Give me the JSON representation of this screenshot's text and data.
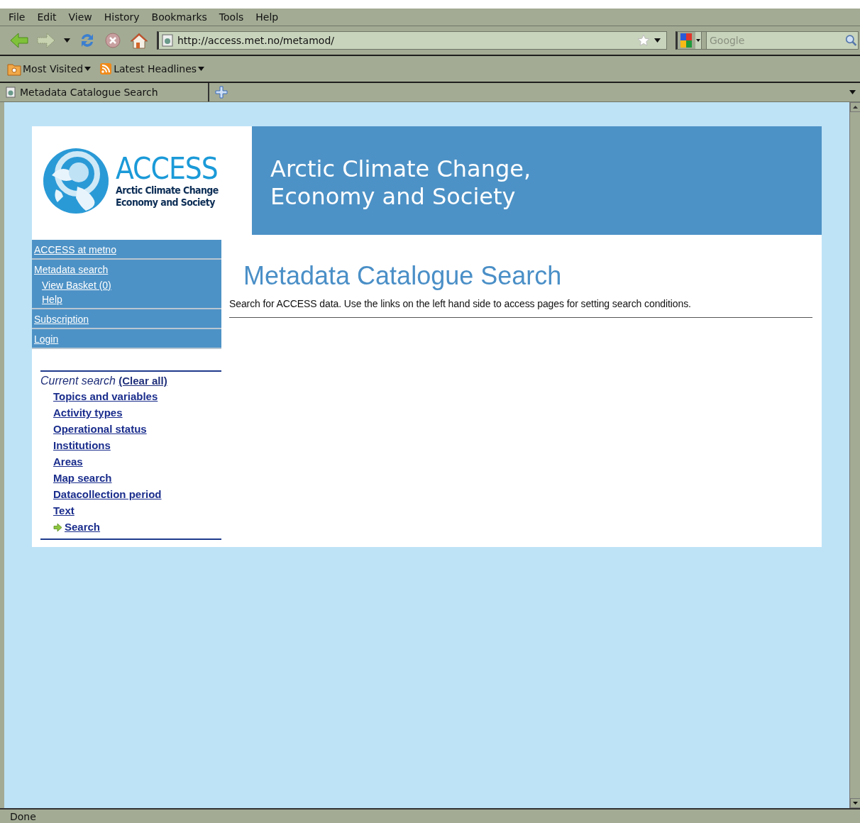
{
  "browser": {
    "menu": [
      "File",
      "Edit",
      "View",
      "History",
      "Bookmarks",
      "Tools",
      "Help"
    ],
    "address": "http://access.met.no/metamod/",
    "search_placeholder": "Google",
    "bookmarks": [
      "Most Visited",
      "Latest Headlines"
    ],
    "tabs": [
      {
        "label": "Metadata Catalogue Search",
        "selected": true
      }
    ],
    "status": "Done"
  },
  "page": {
    "logo": {
      "name": "ACCESS",
      "subtitle": [
        "Arctic Climate Change",
        "Economy and Society"
      ]
    },
    "banner": [
      "Arctic Climate Change,",
      "Economy and Society"
    ],
    "nav": [
      {
        "label": "ACCESS at metno"
      },
      {
        "label": "Metadata search",
        "children": [
          {
            "label": "View Basket (0)"
          },
          {
            "label": "Help"
          }
        ]
      },
      {
        "label": "Subscription"
      },
      {
        "label": "Login"
      }
    ],
    "current_search": {
      "label": "Current search",
      "clear": "(Clear all)",
      "links": [
        {
          "label": "Topics and variables",
          "selected": false
        },
        {
          "label": "Activity types",
          "selected": false
        },
        {
          "label": "Operational status",
          "selected": false
        },
        {
          "label": "Institutions",
          "selected": false
        },
        {
          "label": "Areas",
          "selected": false
        },
        {
          "label": "Map search",
          "selected": false
        },
        {
          "label": "Datacollection period",
          "selected": false
        },
        {
          "label": "Text",
          "selected": false
        },
        {
          "label": "Search",
          "selected": true
        }
      ]
    },
    "title": "Metadata Catalogue Search",
    "intro": "Search for ACCESS data. Use the links on the left hand side to access pages for setting search conditions."
  }
}
